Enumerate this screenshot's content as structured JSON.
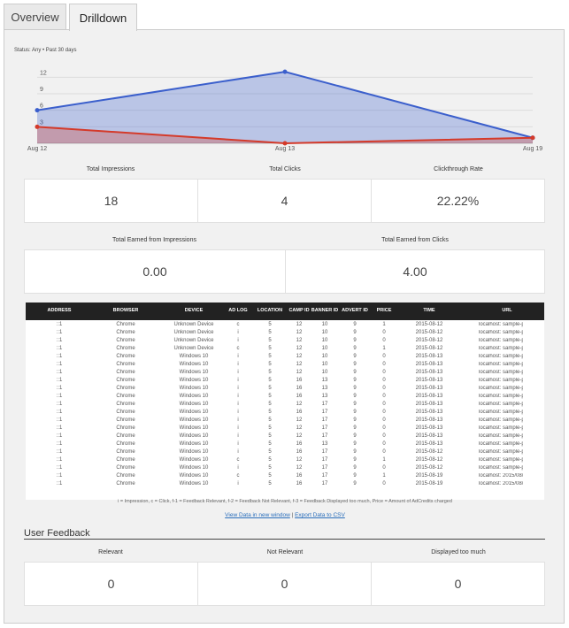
{
  "tabs": [
    {
      "label": "Overview"
    },
    {
      "label": "Drilldown"
    }
  ],
  "status": "Status: Any • Past 30 days",
  "colors": {
    "impressions": "#3b5fcc",
    "clicks": "#d43a2a",
    "table_header": "#222222",
    "link": "#2a6ebb"
  },
  "chart_data": {
    "type": "area",
    "x": [
      "Aug 12",
      "Aug 13",
      "Aug 19"
    ],
    "yticks": [
      3,
      6,
      9,
      12
    ],
    "ylim": [
      0,
      13.5
    ],
    "grid": true,
    "series": [
      {
        "values": [
          6,
          13,
          1
        ],
        "color": "#3b5fcc"
      },
      {
        "values": [
          3,
          0,
          1
        ],
        "color": "#d43a2a"
      }
    ]
  },
  "stats_row1": [
    {
      "label": "Total Impressions",
      "value": "18"
    },
    {
      "label": "Total Clicks",
      "value": "4"
    },
    {
      "label": "Clickthrough Rate",
      "value": "22.22%"
    }
  ],
  "stats_row2": [
    {
      "label": "Total Earned from Impressions",
      "value": "0.00"
    },
    {
      "label": "Total Earned from Clicks",
      "value": "4.00"
    }
  ],
  "table": {
    "headers": [
      "ADDRESS",
      "BROWSER",
      "DEVICE",
      "AD LOG",
      "LOCATION",
      "CAMP ID",
      "BANNER ID",
      "ADVERT ID",
      "PRICE",
      "TIME",
      "URL"
    ],
    "rows": [
      [
        "::1",
        "Chrome",
        "Unknown Device",
        "c",
        "5",
        "12",
        "10",
        "9",
        "1",
        "2015-08-12",
        "localhost:  sample-page/"
      ],
      [
        "::1",
        "Chrome",
        "Unknown Device",
        "i",
        "5",
        "12",
        "10",
        "9",
        "0",
        "2015-08-12",
        "localhost:  sample-page/"
      ],
      [
        "::1",
        "Chrome",
        "Unknown Device",
        "i",
        "5",
        "12",
        "10",
        "9",
        "0",
        "2015-08-12",
        "localhost:  sample-page/"
      ],
      [
        "::1",
        "Chrome",
        "Unknown Device",
        "c",
        "5",
        "12",
        "10",
        "9",
        "1",
        "2015-08-12",
        "localhost:  sample-page/"
      ],
      [
        "::1",
        "Chrome",
        "Windows 10",
        "i",
        "5",
        "12",
        "10",
        "9",
        "0",
        "2015-08-13",
        "localhost:  sample-page/"
      ],
      [
        "::1",
        "Chrome",
        "Windows 10",
        "i",
        "5",
        "12",
        "10",
        "9",
        "0",
        "2015-08-13",
        "localhost:  sample-page/"
      ],
      [
        "::1",
        "Chrome",
        "Windows 10",
        "i",
        "5",
        "12",
        "10",
        "9",
        "0",
        "2015-08-13",
        "localhost:  sample-page/"
      ],
      [
        "::1",
        "Chrome",
        "Windows 10",
        "i",
        "5",
        "16",
        "13",
        "9",
        "0",
        "2015-08-13",
        "localhost:  sample-page/"
      ],
      [
        "::1",
        "Chrome",
        "Windows 10",
        "i",
        "5",
        "16",
        "13",
        "9",
        "0",
        "2015-08-13",
        "localhost:  sample-page/"
      ],
      [
        "::1",
        "Chrome",
        "Windows 10",
        "i",
        "5",
        "16",
        "13",
        "9",
        "0",
        "2015-08-13",
        "localhost:  sample-page/"
      ],
      [
        "::1",
        "Chrome",
        "Windows 10",
        "i",
        "5",
        "12",
        "17",
        "9",
        "0",
        "2015-08-13",
        "localhost:  sample-page/"
      ],
      [
        "::1",
        "Chrome",
        "Windows 10",
        "i",
        "5",
        "16",
        "17",
        "9",
        "0",
        "2015-08-13",
        "localhost:  sample-page/"
      ],
      [
        "::1",
        "Chrome",
        "Windows 10",
        "i",
        "5",
        "12",
        "17",
        "9",
        "0",
        "2015-08-13",
        "localhost:  sample-page/"
      ],
      [
        "::1",
        "Chrome",
        "Windows 10",
        "i",
        "5",
        "12",
        "17",
        "9",
        "0",
        "2015-08-13",
        "localhost:  sample-page/"
      ],
      [
        "::1",
        "Chrome",
        "Windows 10",
        "i",
        "5",
        "12",
        "17",
        "9",
        "0",
        "2015-08-13",
        "localhost:  sample-page/"
      ],
      [
        "::1",
        "Chrome",
        "Windows 10",
        "i",
        "5",
        "16",
        "13",
        "9",
        "0",
        "2015-08-13",
        "localhost:  sample-page/"
      ],
      [
        "::1",
        "Chrome",
        "Windows 10",
        "i",
        "5",
        "16",
        "17",
        "9",
        "0",
        "2015-08-12",
        "localhost:  sample-page/"
      ],
      [
        "::1",
        "Chrome",
        "Windows 10",
        "c",
        "5",
        "12",
        "17",
        "9",
        "1",
        "2015-08-12",
        "localhost:  sample-page/"
      ],
      [
        "::1",
        "Chrome",
        "Windows 10",
        "i",
        "5",
        "12",
        "17",
        "9",
        "0",
        "2015-08-12",
        "localhost:  sample-page/"
      ],
      [
        "::1",
        "Chrome",
        "Windows 10",
        "c",
        "5",
        "16",
        "17",
        "9",
        "1",
        "2015-08-19",
        "localhost:  2015/08/06/h"
      ],
      [
        "::1",
        "Chrome",
        "Windows 10",
        "i",
        "5",
        "16",
        "17",
        "9",
        "0",
        "2015-08-19",
        "localhost:  2015/08/06/h"
      ]
    ]
  },
  "legend": "i = Impression, c = Click, f-1 = Feedback Relevant, f-2 = Feedback Not Relevant, f-3 = Feedback Displayed too much, Price = Amount of AdCredits charged",
  "links": {
    "view": "View Data in new window",
    "sep": "|",
    "export": "Export Data to CSV"
  },
  "feedback": {
    "title": "User Feedback",
    "items": [
      {
        "label": "Relevant",
        "value": "0"
      },
      {
        "label": "Not Relevant",
        "value": "0"
      },
      {
        "label": "Displayed too much",
        "value": "0"
      }
    ]
  }
}
